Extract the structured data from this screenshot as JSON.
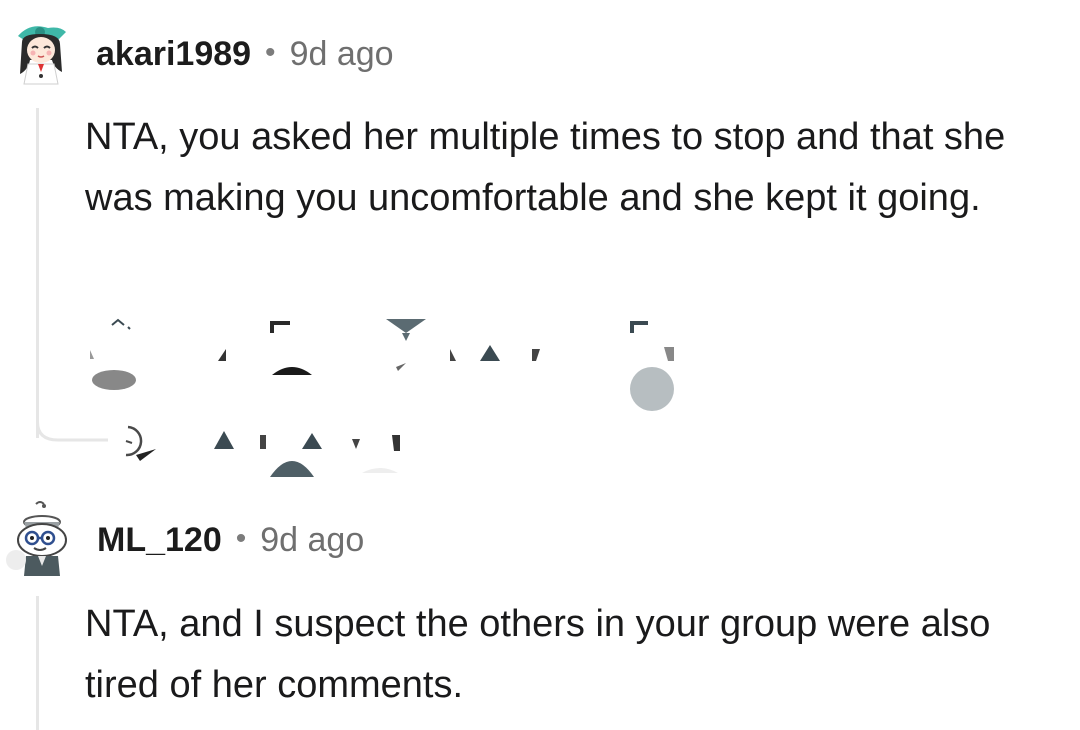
{
  "comments": [
    {
      "username": "akari1989",
      "separator": "•",
      "age": "9d ago",
      "body": "NTA, you asked her multiple times to stop and that she was making you uncomfortable and she kept it going.",
      "avatar_icon": "anime-girl-avatar-icon"
    },
    {
      "username": "ML_120",
      "separator": "•",
      "age": "9d ago",
      "body": "NTA, and I suspect the others in your group were also tired of her comments.",
      "avatar_icon": "snoo-glasses-avatar-icon"
    }
  ],
  "colors": {
    "text": "#1a1a1b",
    "meta": "#6f6f6f",
    "thread_line": "#e6e6e6"
  }
}
